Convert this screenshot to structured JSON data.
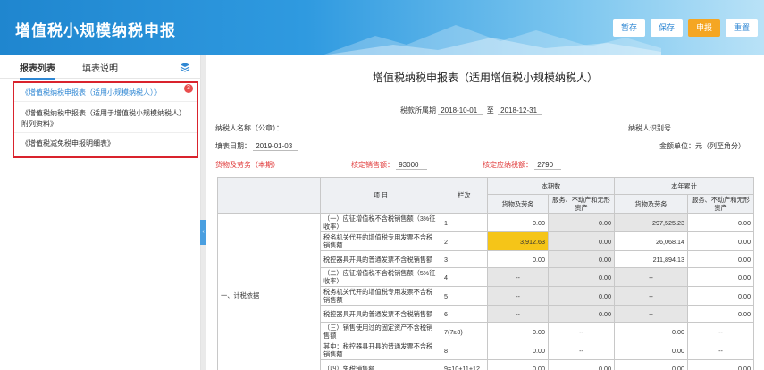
{
  "header": {
    "title": "增值税小规模纳税申报",
    "buttons": [
      "暂存",
      "保存",
      "申报",
      "重置"
    ]
  },
  "left_panel": {
    "tabs": [
      "报表列表",
      "填表说明"
    ],
    "badge": "3",
    "forms": [
      "《增值税纳税申报表（适用小规模纳税人）》",
      "《增值税纳税申报表（适用于增值税小规模纳税人）附列资料》",
      "《增值税减免税申报明细表》"
    ]
  },
  "doc": {
    "title": "增值税纳税申报表（适用增值税小规模纳税人）",
    "period_label": "税款所属期",
    "period_from": "2018-10-01",
    "period_to_label": "至",
    "period_to": "2018-12-31",
    "taxpayer_name_label": "纳税人名称（公章）：",
    "taxpayer_id_label": "纳税人识别号",
    "fill_date_label": "填表日期：",
    "fill_date": "2019-01-03",
    "unit_label": "金额单位：元（列至角分）",
    "goods_label": "货物及劳务（本期）",
    "approved_sales_label": "核定销售额：",
    "approved_sales": "93000",
    "approved_tax_label": "核定应纳税额：",
    "approved_tax": "2790"
  },
  "table": {
    "headers": {
      "item": "项  目",
      "col": "栏次",
      "current": "本期数",
      "ytd": "本年累计",
      "goods": "货物及劳务",
      "service": "服务、不动产和无形资产"
    },
    "section": "一、计税依据",
    "rows": [
      {
        "item": "（一）应征增值税不含税销售额（3%征收率）",
        "col": "1",
        "c1": "0.00",
        "c2": "0.00",
        "y1": "297,525.23",
        "y2": "0.00"
      },
      {
        "item": "税务机关代开的增值税专用发票不含税销售额",
        "col": "2",
        "c1": "3,912.63",
        "c2": "0.00",
        "y1": "26,068.14",
        "y2": "0.00"
      },
      {
        "item": "税控器具开具的普通发票不含税销售额",
        "col": "3",
        "c1": "0.00",
        "c2": "0.00",
        "y1": "211,894.13",
        "y2": "0.00"
      },
      {
        "item": "（二）应征增值税不含税销售额（5%征收率）",
        "col": "4",
        "c1": "--",
        "c2": "0.00",
        "y1": "--",
        "y2": "0.00"
      },
      {
        "item": "税务机关代开的增值税专用发票不含税销售额",
        "col": "5",
        "c1": "--",
        "c2": "0.00",
        "y1": "--",
        "y2": "0.00"
      },
      {
        "item": "税控器具开具的普通发票不含税销售额",
        "col": "6",
        "c1": "--",
        "c2": "0.00",
        "y1": "--",
        "y2": "0.00"
      },
      {
        "item": "（三）销售使用过的固定资产不含税销售额",
        "col": "7(7≥8)",
        "c1": "0.00",
        "c2": "--",
        "y1": "0.00",
        "y2": "--"
      },
      {
        "item": "其中：税控器具开具的普通发票不含税销售额",
        "col": "8",
        "c1": "0.00",
        "c2": "--",
        "y1": "0.00",
        "y2": "--"
      },
      {
        "item": "（四）免税销售额",
        "col": "9=10+11+12",
        "c1": "0.00",
        "c2": "0.00",
        "y1": "0.00",
        "y2": "0.00"
      }
    ]
  },
  "colors": {
    "accent": "#2f87d3",
    "primary_button": "#f5a623",
    "highlight_red": "#d9232d",
    "input_highlight": "#f5c518"
  }
}
